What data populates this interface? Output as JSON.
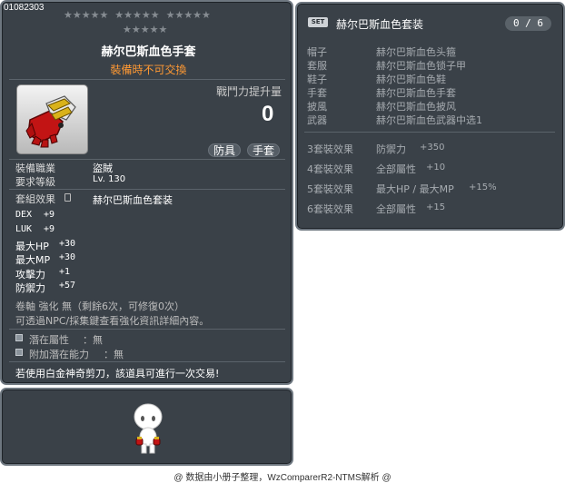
{
  "item": {
    "id": "01082303",
    "name": "赫尔巴斯血色手套",
    "trade_note": "裝備時不可交換",
    "combat_label": "戰鬥力提升量",
    "combat_value": "0",
    "tags": [
      "防具",
      "手套"
    ],
    "job_label": "裝備職業",
    "job_value": "盜賊",
    "level_label": "要求等級",
    "level_value": "Lv. 130",
    "set_label": "套組效果",
    "set_value": "赫尔巴斯血色套装",
    "stats": [
      {
        "name": "DEX",
        "value": "+9"
      },
      {
        "name": "LUK",
        "value": "+9"
      },
      {
        "name": "最大HP",
        "value": "+30"
      },
      {
        "name": "最大MP",
        "value": "+30"
      },
      {
        "name": "攻擊力",
        "value": "+1"
      },
      {
        "name": "防禦力",
        "value": "+57"
      }
    ],
    "upgrade_line": "卷軸 強化 無（剩餘6次，可修復0次）",
    "upgrade_hint": "可透過NPC/採集鍵查看強化資訊詳細內容。",
    "potential_label": "潛在屬性",
    "potential_value": "：無",
    "add_potential_label": "附加潛在能力",
    "add_potential_value": "：無",
    "scissors_note": "若使用白金神奇剪刀，該道具可進行一次交易!"
  },
  "set": {
    "badge": "SET",
    "title": "赫尔巴斯血色套装",
    "count": "0 / 6",
    "pieces": [
      {
        "category": "帽子",
        "name": "赫尔巴斯血色头箍"
      },
      {
        "category": "套服",
        "name": "赫尔巴斯血色锁子甲"
      },
      {
        "category": "鞋子",
        "name": "赫尔巴斯血色鞋"
      },
      {
        "category": "手套",
        "name": "赫尔巴斯血色手套"
      },
      {
        "category": "披風",
        "name": "赫尔巴斯血色披风"
      },
      {
        "category": "武器",
        "name": "赫尔巴斯血色武器中选1"
      }
    ],
    "effects": [
      {
        "count": "3套裝效果",
        "name": "防禦力",
        "value": "+350"
      },
      {
        "count": "4套裝效果",
        "name": "全部屬性",
        "value": "+10"
      },
      {
        "count": "5套裝效果",
        "name": "最大HP / 最大MP",
        "value": "+15%"
      },
      {
        "count": "6套裝效果",
        "name": "全部屬性",
        "value": "+15"
      }
    ]
  },
  "footer": "@ 数据由小册子整理，WzComparerR2-NTMS解析 @",
  "icons": {
    "star": "★",
    "glove": "glove-icon",
    "character": "character-preview"
  },
  "colors": {
    "panel_bg": "#3a4148",
    "trade_note": "#ff9933",
    "title": "#ffffff"
  }
}
